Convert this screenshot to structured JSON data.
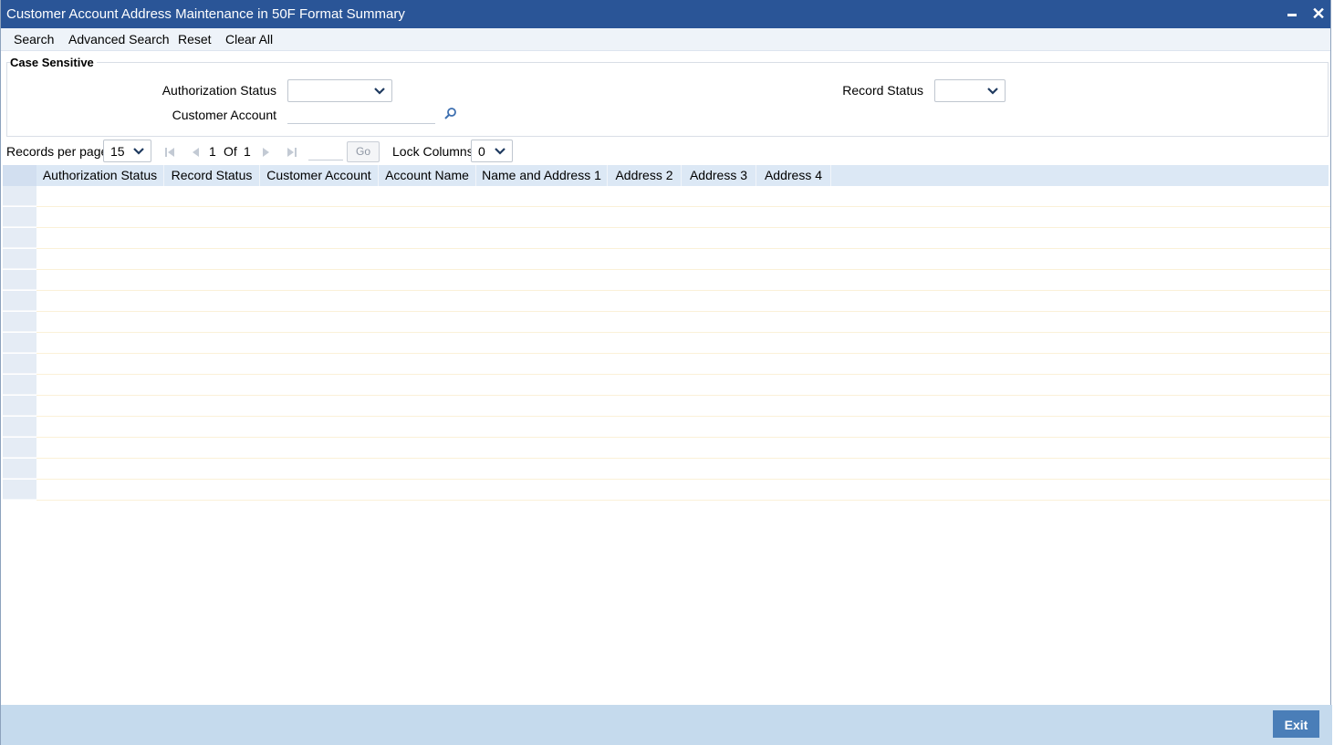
{
  "window": {
    "title": "Customer Account Address Maintenance in 50F Format Summary",
    "colors": {
      "titlebar": "#2a5597",
      "footer": "#c5daed",
      "exit_button": "#4a7eb8"
    }
  },
  "toolbar": {
    "search": "Search",
    "advanced_search": "Advanced Search",
    "reset": "Reset",
    "clear_all": "Clear All"
  },
  "criteria": {
    "legend": "Case Sensitive",
    "authorization_status_label": "Authorization Status",
    "authorization_status_value": "",
    "record_status_label": "Record Status",
    "record_status_value": "",
    "customer_account_label": "Customer Account",
    "customer_account_value": ""
  },
  "pager": {
    "records_per_page_label": "Records per page",
    "records_per_page_value": "15",
    "current_page": "1",
    "of_label": "Of",
    "total_pages": "1",
    "go_label": "Go",
    "lock_columns_label": "Lock Columns",
    "lock_columns_value": "0"
  },
  "grid": {
    "columns": [
      "Authorization Status",
      "Record Status",
      "Customer Account",
      "Account Name",
      "Name and Address 1",
      "Address 2",
      "Address 3",
      "Address 4"
    ],
    "rows": [],
    "empty_row_count": 15
  },
  "footer": {
    "exit": "Exit"
  }
}
